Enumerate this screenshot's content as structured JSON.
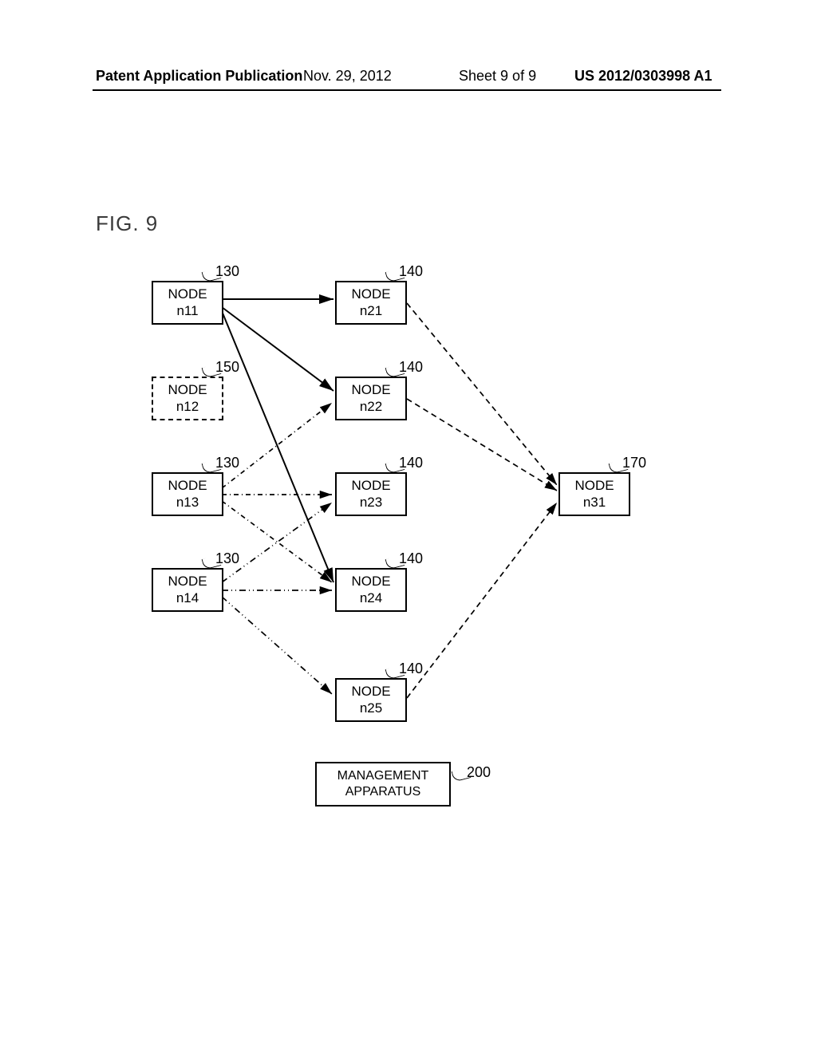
{
  "header": {
    "pub_type": "Patent Application Publication",
    "date": "Nov. 29, 2012",
    "sheet": "Sheet 9 of 9",
    "pubnum": "US 2012/0303998 A1"
  },
  "figure_label": "FIG. 9",
  "nodes": {
    "n11": {
      "line1": "NODE",
      "line2": "n11",
      "ref": "130"
    },
    "n12": {
      "line1": "NODE",
      "line2": "n12",
      "ref": "150"
    },
    "n13": {
      "line1": "NODE",
      "line2": "n13",
      "ref": "130"
    },
    "n14": {
      "line1": "NODE",
      "line2": "n14",
      "ref": "130"
    },
    "n21": {
      "line1": "NODE",
      "line2": "n21",
      "ref": "140"
    },
    "n22": {
      "line1": "NODE",
      "line2": "n22",
      "ref": "140"
    },
    "n23": {
      "line1": "NODE",
      "line2": "n23",
      "ref": "140"
    },
    "n24": {
      "line1": "NODE",
      "line2": "n24",
      "ref": "140"
    },
    "n25": {
      "line1": "NODE",
      "line2": "n25",
      "ref": "140"
    },
    "n31": {
      "line1": "NODE",
      "line2": "n31",
      "ref": "170"
    }
  },
  "management": {
    "line1": "MANAGEMENT",
    "line2": "APPARATUS",
    "ref": "200"
  },
  "chart_data": {
    "type": "diagram",
    "title": "FIG. 9",
    "description": "Node network topology with three tiers and a management apparatus",
    "nodes": [
      {
        "id": "n11",
        "ref": "130",
        "tier": 1
      },
      {
        "id": "n12",
        "ref": "150",
        "tier": 1,
        "style": "dashed"
      },
      {
        "id": "n13",
        "ref": "130",
        "tier": 1
      },
      {
        "id": "n14",
        "ref": "130",
        "tier": 1
      },
      {
        "id": "n21",
        "ref": "140",
        "tier": 2
      },
      {
        "id": "n22",
        "ref": "140",
        "tier": 2
      },
      {
        "id": "n23",
        "ref": "140",
        "tier": 2
      },
      {
        "id": "n24",
        "ref": "140",
        "tier": 2
      },
      {
        "id": "n25",
        "ref": "140",
        "tier": 2
      },
      {
        "id": "n31",
        "ref": "170",
        "tier": 3
      },
      {
        "id": "management",
        "ref": "200",
        "tier": "mgmt"
      }
    ],
    "edges": [
      {
        "from": "n11",
        "to": "n21",
        "style": "solid",
        "arrow": "to"
      },
      {
        "from": "n11",
        "to": "n22",
        "style": "solid",
        "arrow": "to"
      },
      {
        "from": "n11",
        "to": "n24",
        "style": "solid",
        "arrow": "to"
      },
      {
        "from": "n13",
        "to": "n22",
        "style": "dashdot",
        "arrow": "to"
      },
      {
        "from": "n13",
        "to": "n23",
        "style": "dashdot",
        "arrow": "to"
      },
      {
        "from": "n13",
        "to": "n24",
        "style": "dashdot",
        "arrow": "to"
      },
      {
        "from": "n14",
        "to": "n23",
        "style": "dashdot2",
        "arrow": "to"
      },
      {
        "from": "n14",
        "to": "n24",
        "style": "dashdot2",
        "arrow": "to"
      },
      {
        "from": "n14",
        "to": "n25",
        "style": "dashdot2",
        "arrow": "to"
      },
      {
        "from": "n21",
        "to": "n31",
        "style": "dashed",
        "arrow": "to"
      },
      {
        "from": "n22",
        "to": "n31",
        "style": "dashed",
        "arrow": "to"
      },
      {
        "from": "n25",
        "to": "n31",
        "style": "dashed",
        "arrow": "to"
      }
    ]
  }
}
